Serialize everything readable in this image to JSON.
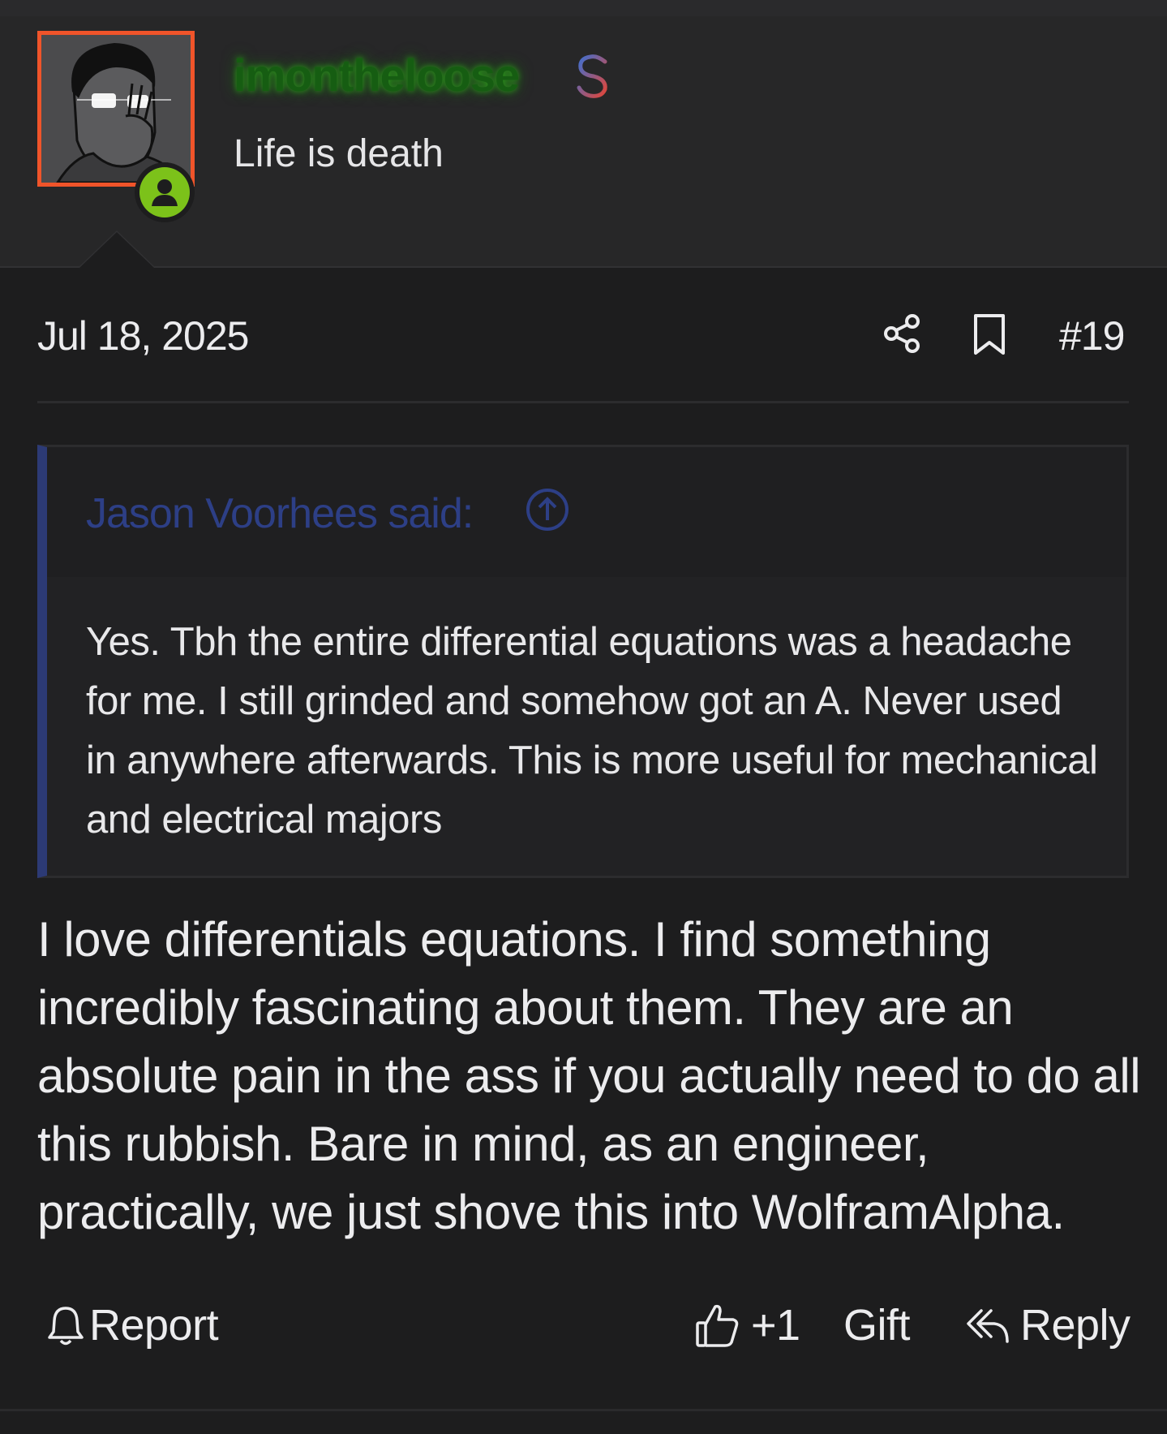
{
  "user": {
    "username": "imontheloose",
    "user_title": "Life is death",
    "avatar_icon": "wojak-avatar",
    "badge_icon": "user-online-icon",
    "premium_icon": "dollar-icon",
    "colors": {
      "avatar_border": "#f0542a",
      "online": "#7cc21a",
      "username": "#165d12"
    }
  },
  "post": {
    "date": "Jul 18, 2025",
    "number": "#19",
    "share_icon": "share-icon",
    "bookmark_icon": "bookmark-icon"
  },
  "quote": {
    "author_label": "Jason Voorhees said:",
    "body": "Yes. Tbh the entire differential equations was a headache for me. I still grinded and somehow got an A. Never used in anywhere afterwards. This is more useful for mechanical and electrical majors",
    "accent_color": "#2c3a75"
  },
  "body": "I love differentials equations. I find something incredibly fascinating about them. They are an absolute pain in the ass if you actually need to do all this rubbish. Bare in mind, as an engineer, practically, we just shove this into WolframAlpha.",
  "actions": {
    "report_label": "Report",
    "like_label": "+1",
    "gift_label": "Gift",
    "reply_label": "Reply"
  }
}
